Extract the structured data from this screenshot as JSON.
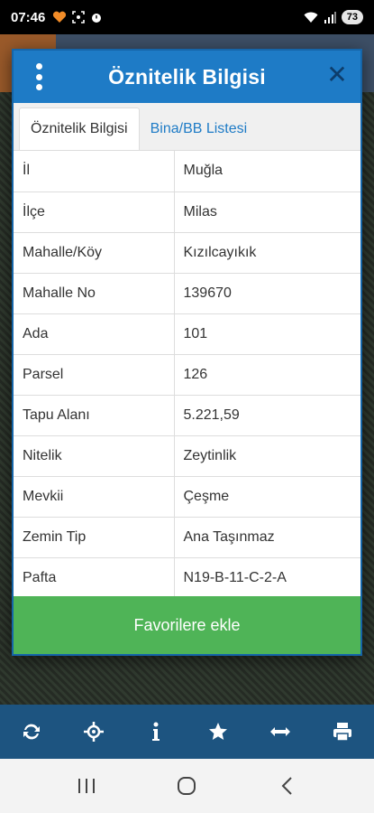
{
  "status_bar": {
    "time": "07:46",
    "battery": "73"
  },
  "dialog": {
    "title": "Öznitelik Bilgisi",
    "close_glyph": "✕",
    "tabs": [
      {
        "label": "Öznitelik Bilgisi",
        "active": true
      },
      {
        "label": "Bina/BB Listesi",
        "active": false
      }
    ],
    "rows": [
      {
        "key": "İl",
        "value": "Muğla"
      },
      {
        "key": "İlçe",
        "value": "Milas"
      },
      {
        "key": "Mahalle/Köy",
        "value": "Kızılcayıkık"
      },
      {
        "key": "Mahalle No",
        "value": "139670"
      },
      {
        "key": "Ada",
        "value": "101"
      },
      {
        "key": "Parsel",
        "value": "126"
      },
      {
        "key": "Tapu Alanı",
        "value": "5.221,59"
      },
      {
        "key": "Nitelik",
        "value": "Zeytinlik"
      },
      {
        "key": "Mevkii",
        "value": "Çeşme"
      },
      {
        "key": "Zemin Tip",
        "value": "Ana Taşınmaz"
      },
      {
        "key": "Pafta",
        "value": "N19-B-11-C-2-A"
      }
    ],
    "favorite_button": "Favorilere ekle"
  },
  "toolbar": {
    "icons": [
      "refresh-icon",
      "locate-icon",
      "info-icon",
      "star-icon",
      "measure-icon",
      "print-icon"
    ]
  },
  "colors": {
    "header_blue": "#1e7bc6",
    "toolbar_blue": "#1d5480",
    "favorite_green": "#4fb457"
  }
}
